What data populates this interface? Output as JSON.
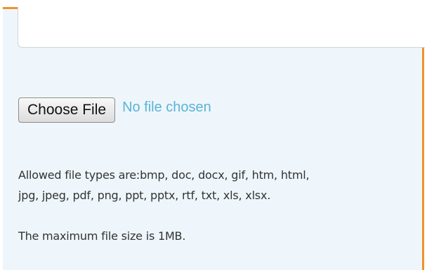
{
  "upload": {
    "choose_file_label": "Choose File",
    "no_file_text": "No file chosen"
  },
  "info": {
    "allowed_types_line1": "Allowed file types are:bmp, doc, docx, gif, htm, html,",
    "allowed_types_line2": "jpg, jpeg, pdf, png, ppt, pptx, rtf, txt, xls, xlsx.",
    "max_size": "The maximum file size is 1MB."
  },
  "colors": {
    "panel_border": "#f0922a",
    "panel_background": "#eef6fb",
    "no_file_text": "#5ab4d6"
  }
}
